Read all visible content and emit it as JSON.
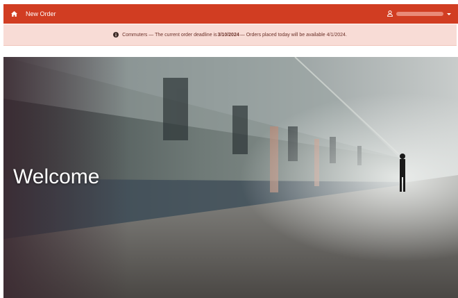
{
  "navbar": {
    "home_icon": "home-icon",
    "new_order_label": "New Order",
    "user_icon": "user-icon",
    "colors": {
      "background": "#d13d22",
      "text": "#ffffff"
    }
  },
  "alert": {
    "icon": "info-circle-icon",
    "prefix": "Commuters — The current order deadline is ",
    "deadline": "3/10/2024",
    "suffix": " — Orders placed today will be available 4/1/2024.",
    "colors": {
      "background": "#f8dcd6",
      "text": "#6b3028"
    }
  },
  "hero": {
    "heading": "Welcome"
  }
}
